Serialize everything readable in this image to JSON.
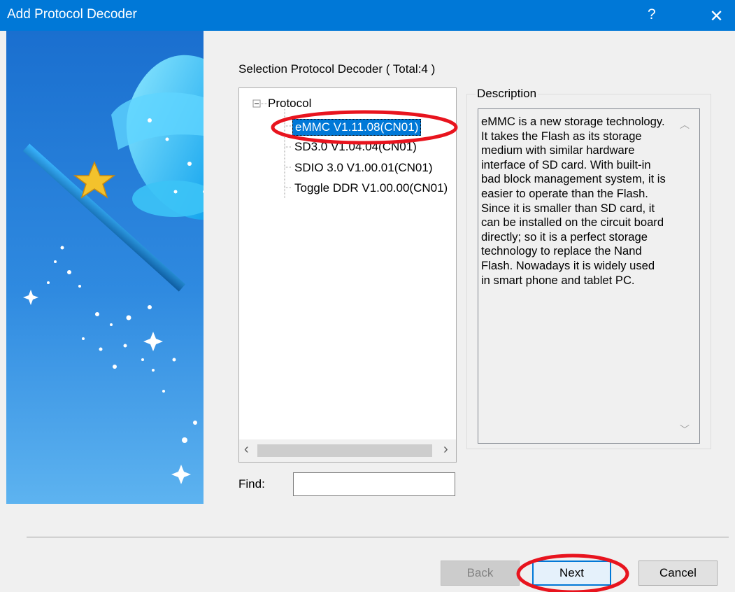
{
  "window": {
    "title": "Add Protocol Decoder",
    "help_glyph": "?",
    "close_glyph": "✕"
  },
  "main": {
    "heading": "Selection Protocol Decoder ( Total:4 )",
    "tree": {
      "root_label": "Protocol",
      "items": [
        "eMMC V1.11.08(CN01)",
        "SD3.0 V1.04.04(CN01)",
        "SDIO 3.0 V1.00.01(CN01)",
        "Toggle DDR V1.00.00(CN01)"
      ],
      "selected_index": 0
    },
    "description": {
      "label": "Description",
      "text": "eMMC is a new storage technology. It takes the Flash as its storage medium with similar hardware interface of SD card. With built-in bad block management system, it is easier to operate than the Flash. Since it is smaller than SD card, it can be installed on the circuit board directly; so it is a perfect storage technology to replace the Nand Flash. Nowadays it is widely used in smart phone and tablet PC."
    },
    "find": {
      "label": "Find:",
      "value": ""
    }
  },
  "buttons": {
    "back": "Back",
    "next": "Next",
    "cancel": "Cancel"
  },
  "colors": {
    "titlebar": "#0078d7",
    "selection": "#0078d7",
    "annotation": "#e8141e"
  }
}
